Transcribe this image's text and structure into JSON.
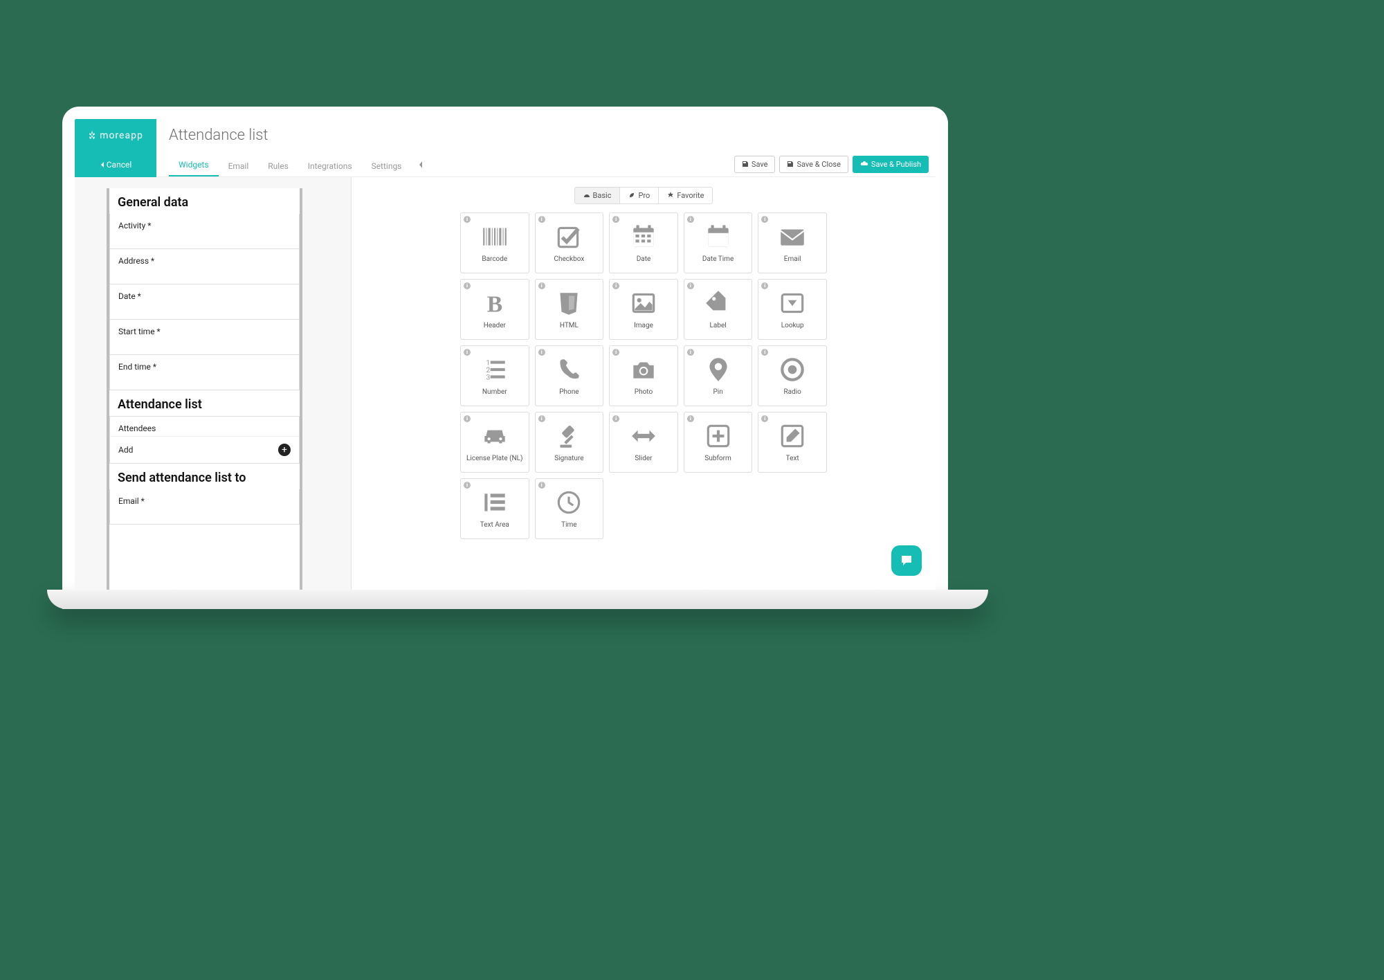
{
  "brand": "moreapp",
  "page_title": "Attendance list",
  "cancel_label": "Cancel",
  "tabs": {
    "widgets": "Widgets",
    "email": "Email",
    "rules": "Rules",
    "integrations": "Integrations",
    "settings": "Settings"
  },
  "save": {
    "save": "Save",
    "save_close": "Save & Close",
    "save_publish": "Save & Publish"
  },
  "form": {
    "section1": "General data",
    "activity": "Activity *",
    "address": "Address *",
    "date": "Date *",
    "start_time": "Start time *",
    "end_time": "End time *",
    "section2": "Attendance list",
    "attendees": "Attendees",
    "add": "Add",
    "section3": "Send attendance list to",
    "email": "Email *"
  },
  "filters": {
    "basic": "Basic",
    "pro": "Pro",
    "favorite": "Favorite"
  },
  "widgets": {
    "barcode": "Barcode",
    "checkbox": "Checkbox",
    "date": "Date",
    "datetime": "Date Time",
    "email": "Email",
    "header": "Header",
    "html": "HTML",
    "image": "Image",
    "label": "Label",
    "lookup": "Lookup",
    "number": "Number",
    "phone": "Phone",
    "photo": "Photo",
    "pin": "Pin",
    "radio": "Radio",
    "license": "License Plate (NL)",
    "signature": "Signature",
    "slider": "Slider",
    "subform": "Subform",
    "text": "Text",
    "textarea": "Text Area",
    "time": "Time"
  }
}
